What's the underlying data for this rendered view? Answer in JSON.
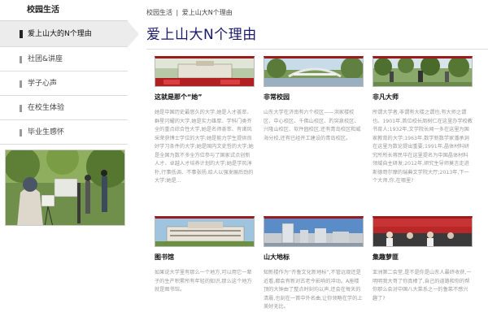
{
  "sidebar": {
    "title": "校园生活",
    "items": [
      {
        "label": "爱上山大的N个理由",
        "active": true
      },
      {
        "label": "社团&讲座",
        "active": false
      },
      {
        "label": "学子心声",
        "active": false
      },
      {
        "label": "在校生体验",
        "active": false
      },
      {
        "label": "毕业生感怀",
        "active": false
      }
    ]
  },
  "breadcrumb": {
    "part1": "校园生活",
    "sep": "|",
    "part2": "爱上山大N个理由"
  },
  "page_title": "爱上山大N个理由",
  "cards": [
    {
      "title": "这就是那个“她”",
      "body": "她是中国历史最悠久的大学,她是人才荟萃、群星闪耀的大学,她是实力雄厚、学科门类齐全的重点综合性大学,她是名师荟萃、有诸风采荣获博士学位的大学;她是能力学生提供良好学习条件的大学;她是国内文史哲的大学;她是全国为数不多全方位参与了国家试点创新人才、卓越人才培养计划的大学;她是学风淳朴,行事低调、不事张扬,给人以强发展后劲的大学;她是..."
    },
    {
      "title": "非常校园",
      "body": "山东大学在济南有六个校区——洪家楼校区、中心校区、千佛山校区、趵突泉校区、兴隆山校区、软件园校区,还有青岛校区和威海分校,还有已经开工建设的青岛校区。"
    },
    {
      "title": "非凡大师",
      "body": "所谓大学者,非谓有大楼之谓也,有大师之谓也。1901年,首位校长周树仁在这里办学校教书育人;1932年,文学院长闻一多在这里为国家教育的大学;1963年,数学新数学家潘承洞在这里为数论提出重要;1991年,晶体材料研究所所长蒋民华在这里提名为中国晶体材料领域自主研发;2012年,研究生导师莫言走进斯德哥尔摩的瑞典文学院大厅;2013年,下一个大师,你,在哪里?"
    },
    {
      "title": "图书馆",
      "body": "如果说大学里有那么一个地方,可以用它一辈子的生产积累所有年轻的知识,那么这个地方就是图书馆。"
    },
    {
      "title": "山大地标",
      "body": "知新楼作为“齐鲁文化新地标”,不管远观还是近看,都会有新对古老今影响的冲动。A座楼顶的大钟由了整点时刻均以声,还会在每天的清晨,也刻在一首中外名曲,让你领略在学的上美好无比。"
    },
    {
      "title": "集趣萝匪",
      "body": "亚洲第二会堂,是不是你是山东人最终收获,一明明我大哥了你真棒了,自己的道路和你的帮你那么会对中国八大菜系之一的鲁菜不感兴趣了?"
    }
  ],
  "colors": {
    "title_color": "#1a1a6a",
    "thumb_accent": "#9a1b1b",
    "active_bg": "#ececec"
  }
}
